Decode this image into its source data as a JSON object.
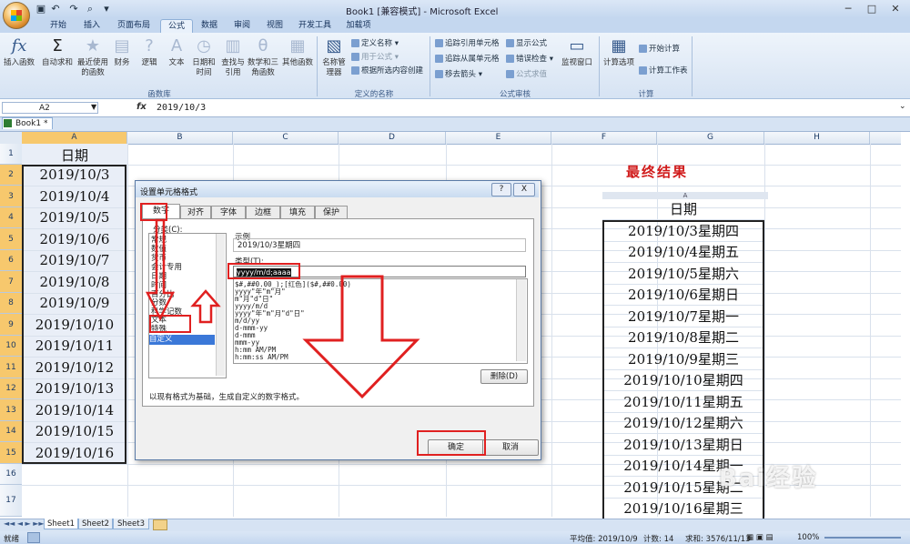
{
  "window": {
    "title": "Book1 [兼容模式] - Microsoft Excel"
  },
  "ribbon": {
    "tabs": [
      "开始",
      "插入",
      "页面布局",
      "公式",
      "数据",
      "审阅",
      "视图",
      "开发工具",
      "加载项"
    ],
    "active_tab": "公式",
    "function_library": {
      "label": "函数库",
      "buttons": [
        "插入函数",
        "自动求和",
        "最近使用的函数",
        "财务",
        "逻辑",
        "文本",
        "日期和时间",
        "查找与引用",
        "数学和三角函数",
        "其他函数"
      ]
    },
    "defined_names": {
      "label": "定义的名称",
      "name_manager": "名称管理器",
      "items": [
        "定义名称",
        "用于公式",
        "根据所选内容创建"
      ]
    },
    "auditing": {
      "label": "公式审核",
      "items": [
        "追踪引用单元格",
        "显示公式",
        "追踪从属单元格",
        "错误检查",
        "移去箭头",
        "公式求值"
      ],
      "watch_window": "监视窗口"
    },
    "calculation": {
      "label": "计算",
      "options": "计算选项",
      "items": [
        "开始计算",
        "计算工作表"
      ]
    }
  },
  "formula_bar": {
    "name_box": "A2",
    "fx": "fx",
    "value": "2019/10/3"
  },
  "workbook": {
    "tab": "Book1 *"
  },
  "grid": {
    "columns": [
      "A",
      "B",
      "C",
      "D",
      "E",
      "F",
      "G",
      "H"
    ],
    "rows": [
      "1",
      "2",
      "3",
      "4",
      "5",
      "6",
      "7",
      "8",
      "9",
      "10",
      "11",
      "12",
      "13",
      "14",
      "15",
      "16",
      "17"
    ],
    "header_text": "日期",
    "dates": [
      "2019/10/3",
      "2019/10/4",
      "2019/10/5",
      "2019/10/6",
      "2019/10/7",
      "2019/10/8",
      "2019/10/9",
      "2019/10/10",
      "2019/10/11",
      "2019/10/12",
      "2019/10/13",
      "2019/10/14",
      "2019/10/15",
      "2019/10/16"
    ]
  },
  "result": {
    "title": "最终结果",
    "col_letter": "A",
    "header": "日期",
    "values": [
      "2019/10/3星期四",
      "2019/10/4星期五",
      "2019/10/5星期六",
      "2019/10/6星期日",
      "2019/10/7星期一",
      "2019/10/8星期二",
      "2019/10/9星期三",
      "2019/10/10星期四",
      "2019/10/11星期五",
      "2019/10/12星期六",
      "2019/10/13星期日",
      "2019/10/14星期一",
      "2019/10/15星期二",
      "2019/10/16星期三"
    ]
  },
  "dialog": {
    "title": "设置单元格格式",
    "tabs": [
      "数字",
      "对齐",
      "字体",
      "边框",
      "填充",
      "保护"
    ],
    "category_label": "分类(C):",
    "categories": [
      "常规",
      "数值",
      "货币",
      "会计专用",
      "日期",
      "时间",
      "百分比",
      "分数",
      "科学记数",
      "文本",
      "特殊",
      "自定义"
    ],
    "selected_category": "自定义",
    "sample_label": "示例",
    "sample_value": "2019/10/3星期四",
    "type_label": "类型(T):",
    "type_value": "yyyy/m/d;aaaa",
    "formats": [
      "$#,##0.00_);[红色]($#,##0.00)",
      "yyyy\"年\"m\"月\"",
      "m\"月\"d\"日\"",
      "yyyy/m/d",
      "yyyy\"年\"m\"月\"d\"日\"",
      "m/d/yy",
      "d-mmm-yy",
      "d-mmm",
      "mmm-yy",
      "h:mm AM/PM",
      "h:mm:ss AM/PM"
    ],
    "delete_button": "删除(D)",
    "description": "以现有格式为基础，生成自定义的数字格式。",
    "ok_button": "确定",
    "cancel_button": "取消",
    "help_icon": "?",
    "close_icon": "X"
  },
  "sheets": [
    "Sheet1",
    "Sheet2",
    "Sheet3"
  ],
  "status": {
    "ready": "就绪",
    "average": "平均值: 2019/10/9",
    "count": "计数: 14",
    "sum": "求和: 3576/11/13",
    "zoom": "100%"
  },
  "watermark": "Bai经验"
}
